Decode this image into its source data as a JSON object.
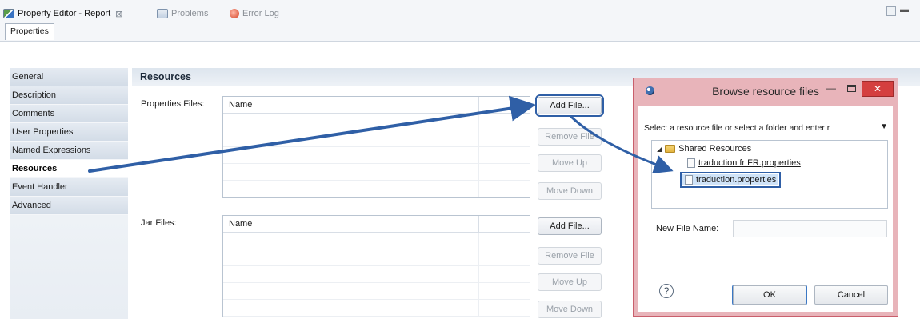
{
  "view_tabs": {
    "active": "Property Editor - Report",
    "inactive": [
      "Problems",
      "Error Log"
    ],
    "sub_tab": "Properties"
  },
  "categories": [
    "General",
    "Description",
    "Comments",
    "User Properties",
    "Named Expressions",
    "Resources",
    "Event Handler",
    "Advanced"
  ],
  "selected_category": "Resources",
  "section_title": "Resources",
  "properties_files": {
    "label": "Properties Files:",
    "column": "Name",
    "buttons": {
      "add": "Add File...",
      "remove": "Remove File",
      "up": "Move Up",
      "down": "Move Down"
    }
  },
  "jar_files": {
    "label": "Jar Files:",
    "column": "Name",
    "buttons": {
      "add": "Add File...",
      "remove": "Remove File",
      "up": "Move Up",
      "down": "Move Down"
    }
  },
  "dialog": {
    "title": "Browse resource files",
    "prompt": "Select a resource file or select a folder and enter r",
    "tree": {
      "root": "Shared Resources",
      "children": [
        "traduction fr FR.properties",
        "traduction.properties"
      ],
      "selected": "traduction.properties"
    },
    "new_file_label": "New File Name:",
    "new_file_value": "",
    "ok": "OK",
    "cancel": "Cancel",
    "help_icon": "?",
    "close_glyph": "✕"
  },
  "colors": {
    "arrow": "#2f5fa6",
    "dialog_frame": "#e8b4ba",
    "dialog_close": "#d43f3f"
  }
}
